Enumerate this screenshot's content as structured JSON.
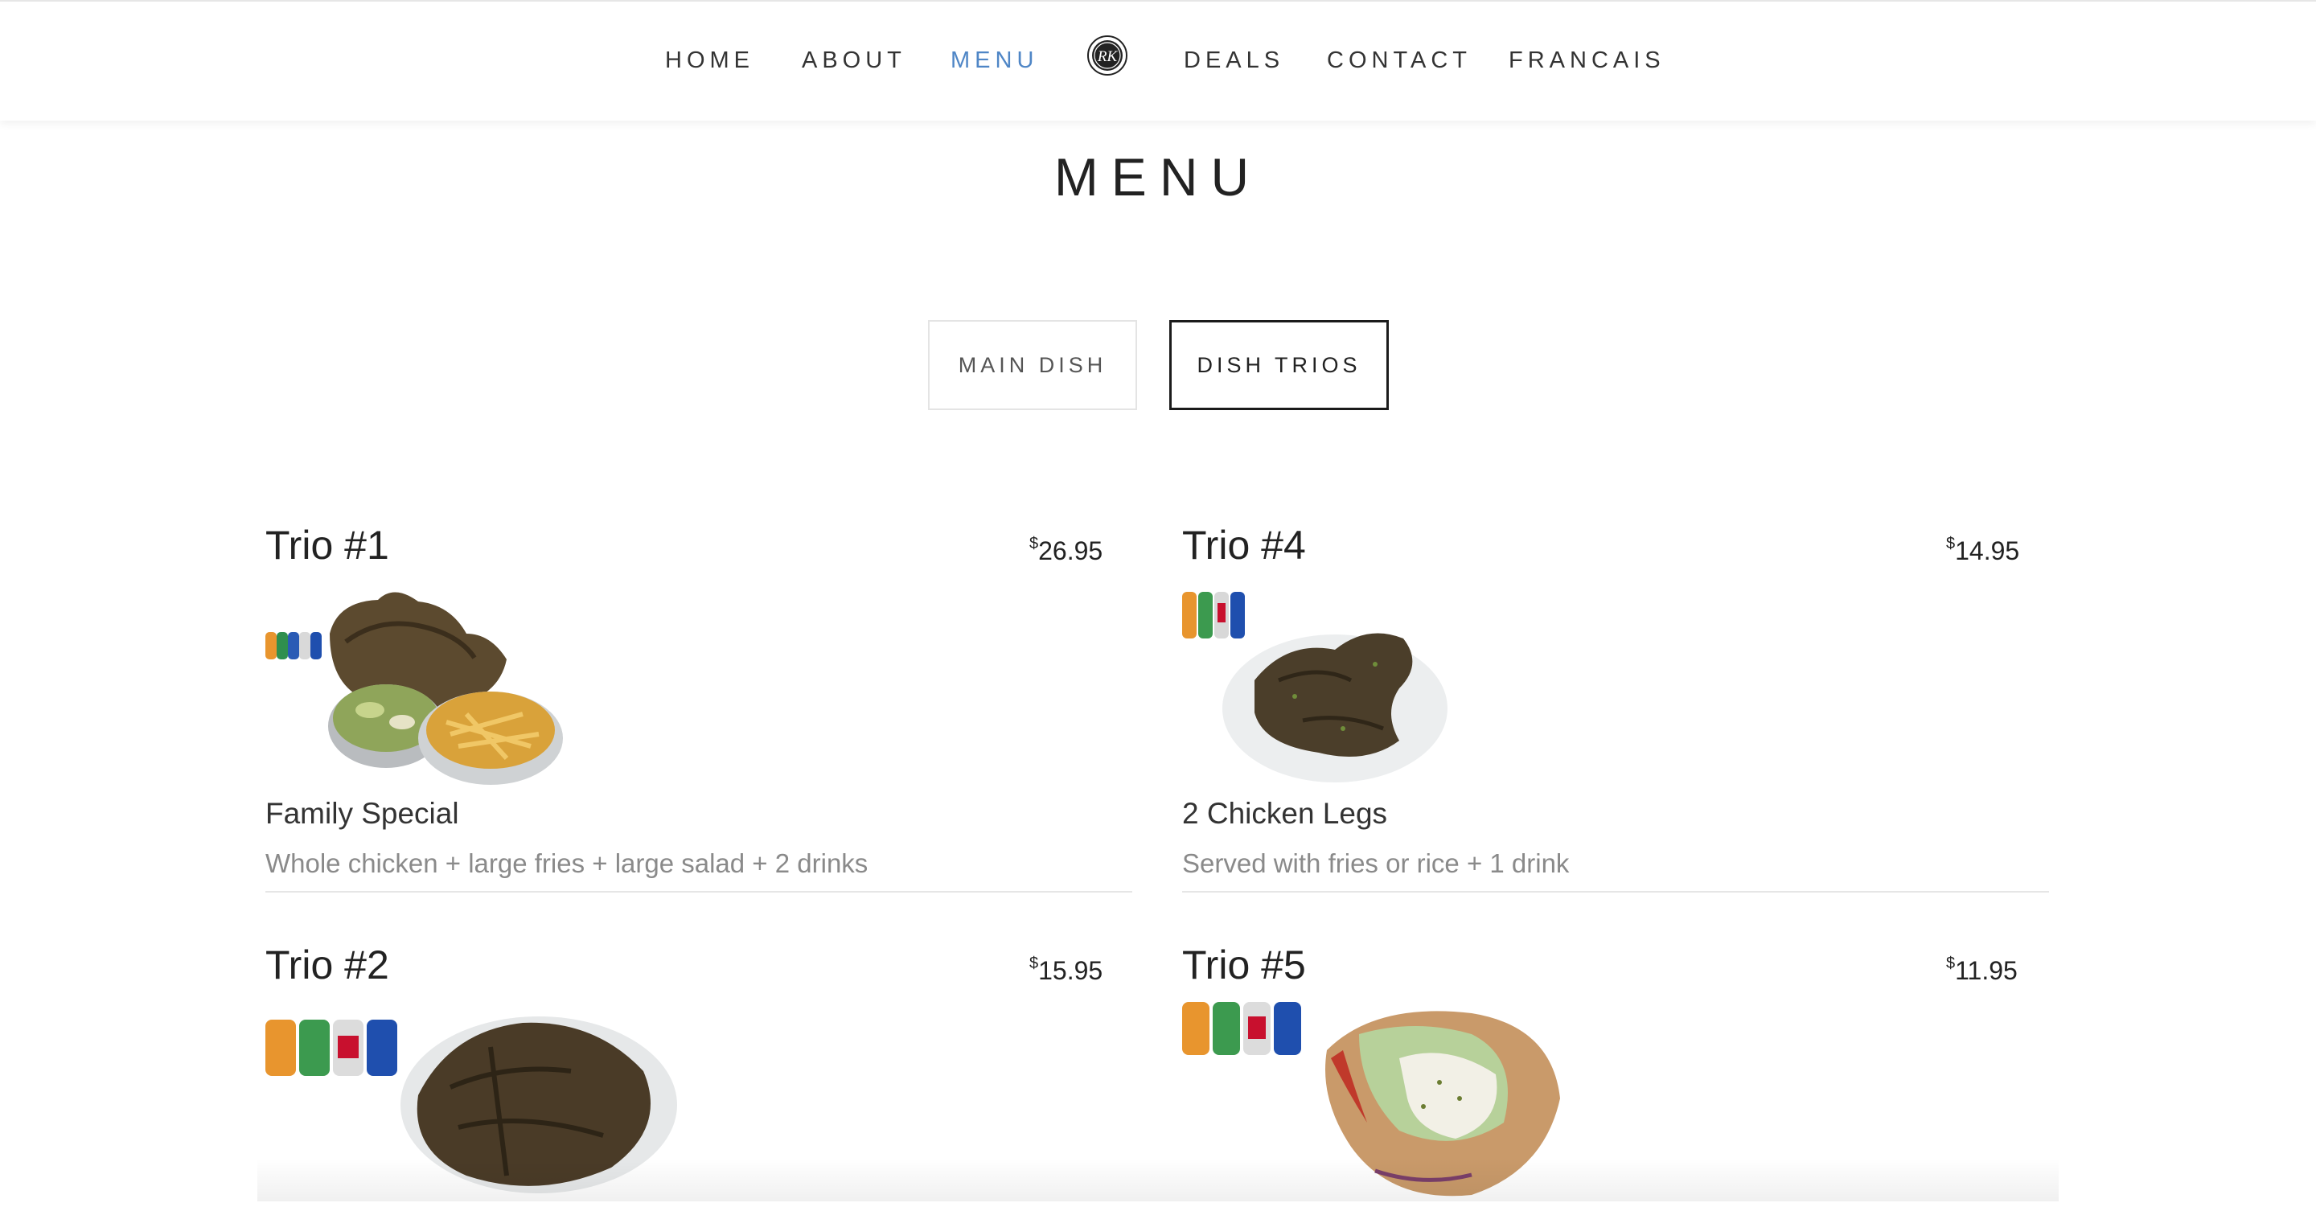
{
  "nav": {
    "items": [
      {
        "label": "HOME",
        "active": false
      },
      {
        "label": "ABOUT",
        "active": false
      },
      {
        "label": "MENU",
        "active": true
      },
      {
        "label": "DEALS",
        "active": false
      },
      {
        "label": "CONTACT",
        "active": false
      },
      {
        "label": "FRANCAIS",
        "active": false
      }
    ],
    "logo_icon": "rk-monogram-logo-icon"
  },
  "page": {
    "title": "MENU"
  },
  "tabs": [
    {
      "label": "MAIN DISH",
      "selected": false
    },
    {
      "label": "DISH TRIOS",
      "selected": true
    }
  ],
  "items": [
    {
      "name": "Trio #1",
      "currency": "$",
      "price": "26.95",
      "subtitle": "Family Special",
      "description": "Whole chicken + large fries + large salad + 2 drinks",
      "photo_icon": "whole-chicken-salad-fries-drinks-photo"
    },
    {
      "name": "Trio #4",
      "currency": "$",
      "price": "14.95",
      "subtitle": "2 Chicken Legs",
      "description": "Served with fries or rice + 1 drink",
      "photo_icon": "chicken-legs-drinks-photo"
    },
    {
      "name": "Trio #2",
      "currency": "$",
      "price": "15.95",
      "subtitle": "",
      "description": "",
      "photo_icon": "chicken-plate-drinks-photo"
    },
    {
      "name": "Trio #5",
      "currency": "$",
      "price": "11.95",
      "subtitle": "",
      "description": "",
      "photo_icon": "shawarma-wrap-drinks-photo"
    }
  ],
  "colors": {
    "accent": "#4f86c6",
    "text": "#222222",
    "muted": "#8a8a8a",
    "rule": "#e6e6e6"
  }
}
